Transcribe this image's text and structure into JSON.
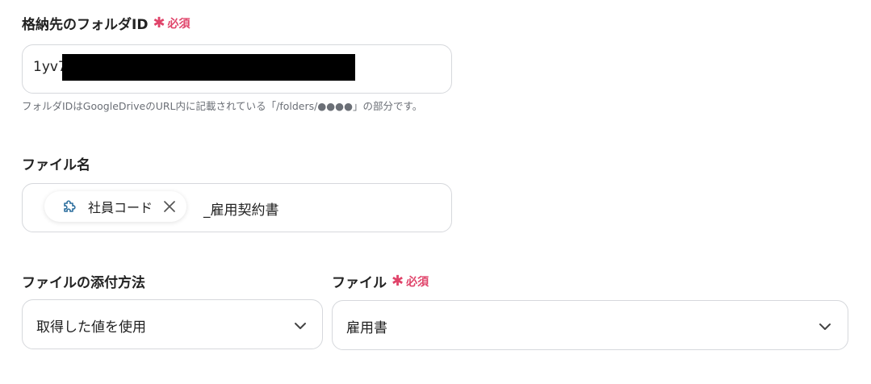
{
  "folder_id": {
    "label": "格納先のフォルダID",
    "required_label": "必須",
    "value": "1yv7",
    "hint": "フォルダIDはGoogleDriveのURL内に記載されている「/folders/●●●●」の部分です。"
  },
  "file_name": {
    "label": "ファイル名",
    "chip_label": "社員コード",
    "chip_icon": "puzzle-icon",
    "suffix_text": "_雇用契約書"
  },
  "attach_method": {
    "label": "ファイルの添付方法",
    "selected": "取得した値を使用"
  },
  "file": {
    "label": "ファイル",
    "required_label": "必須",
    "selected": "雇用書"
  },
  "colors": {
    "required": "#e0446a",
    "chip_icon": "#2d6f9e",
    "border": "#d6d8dc"
  }
}
